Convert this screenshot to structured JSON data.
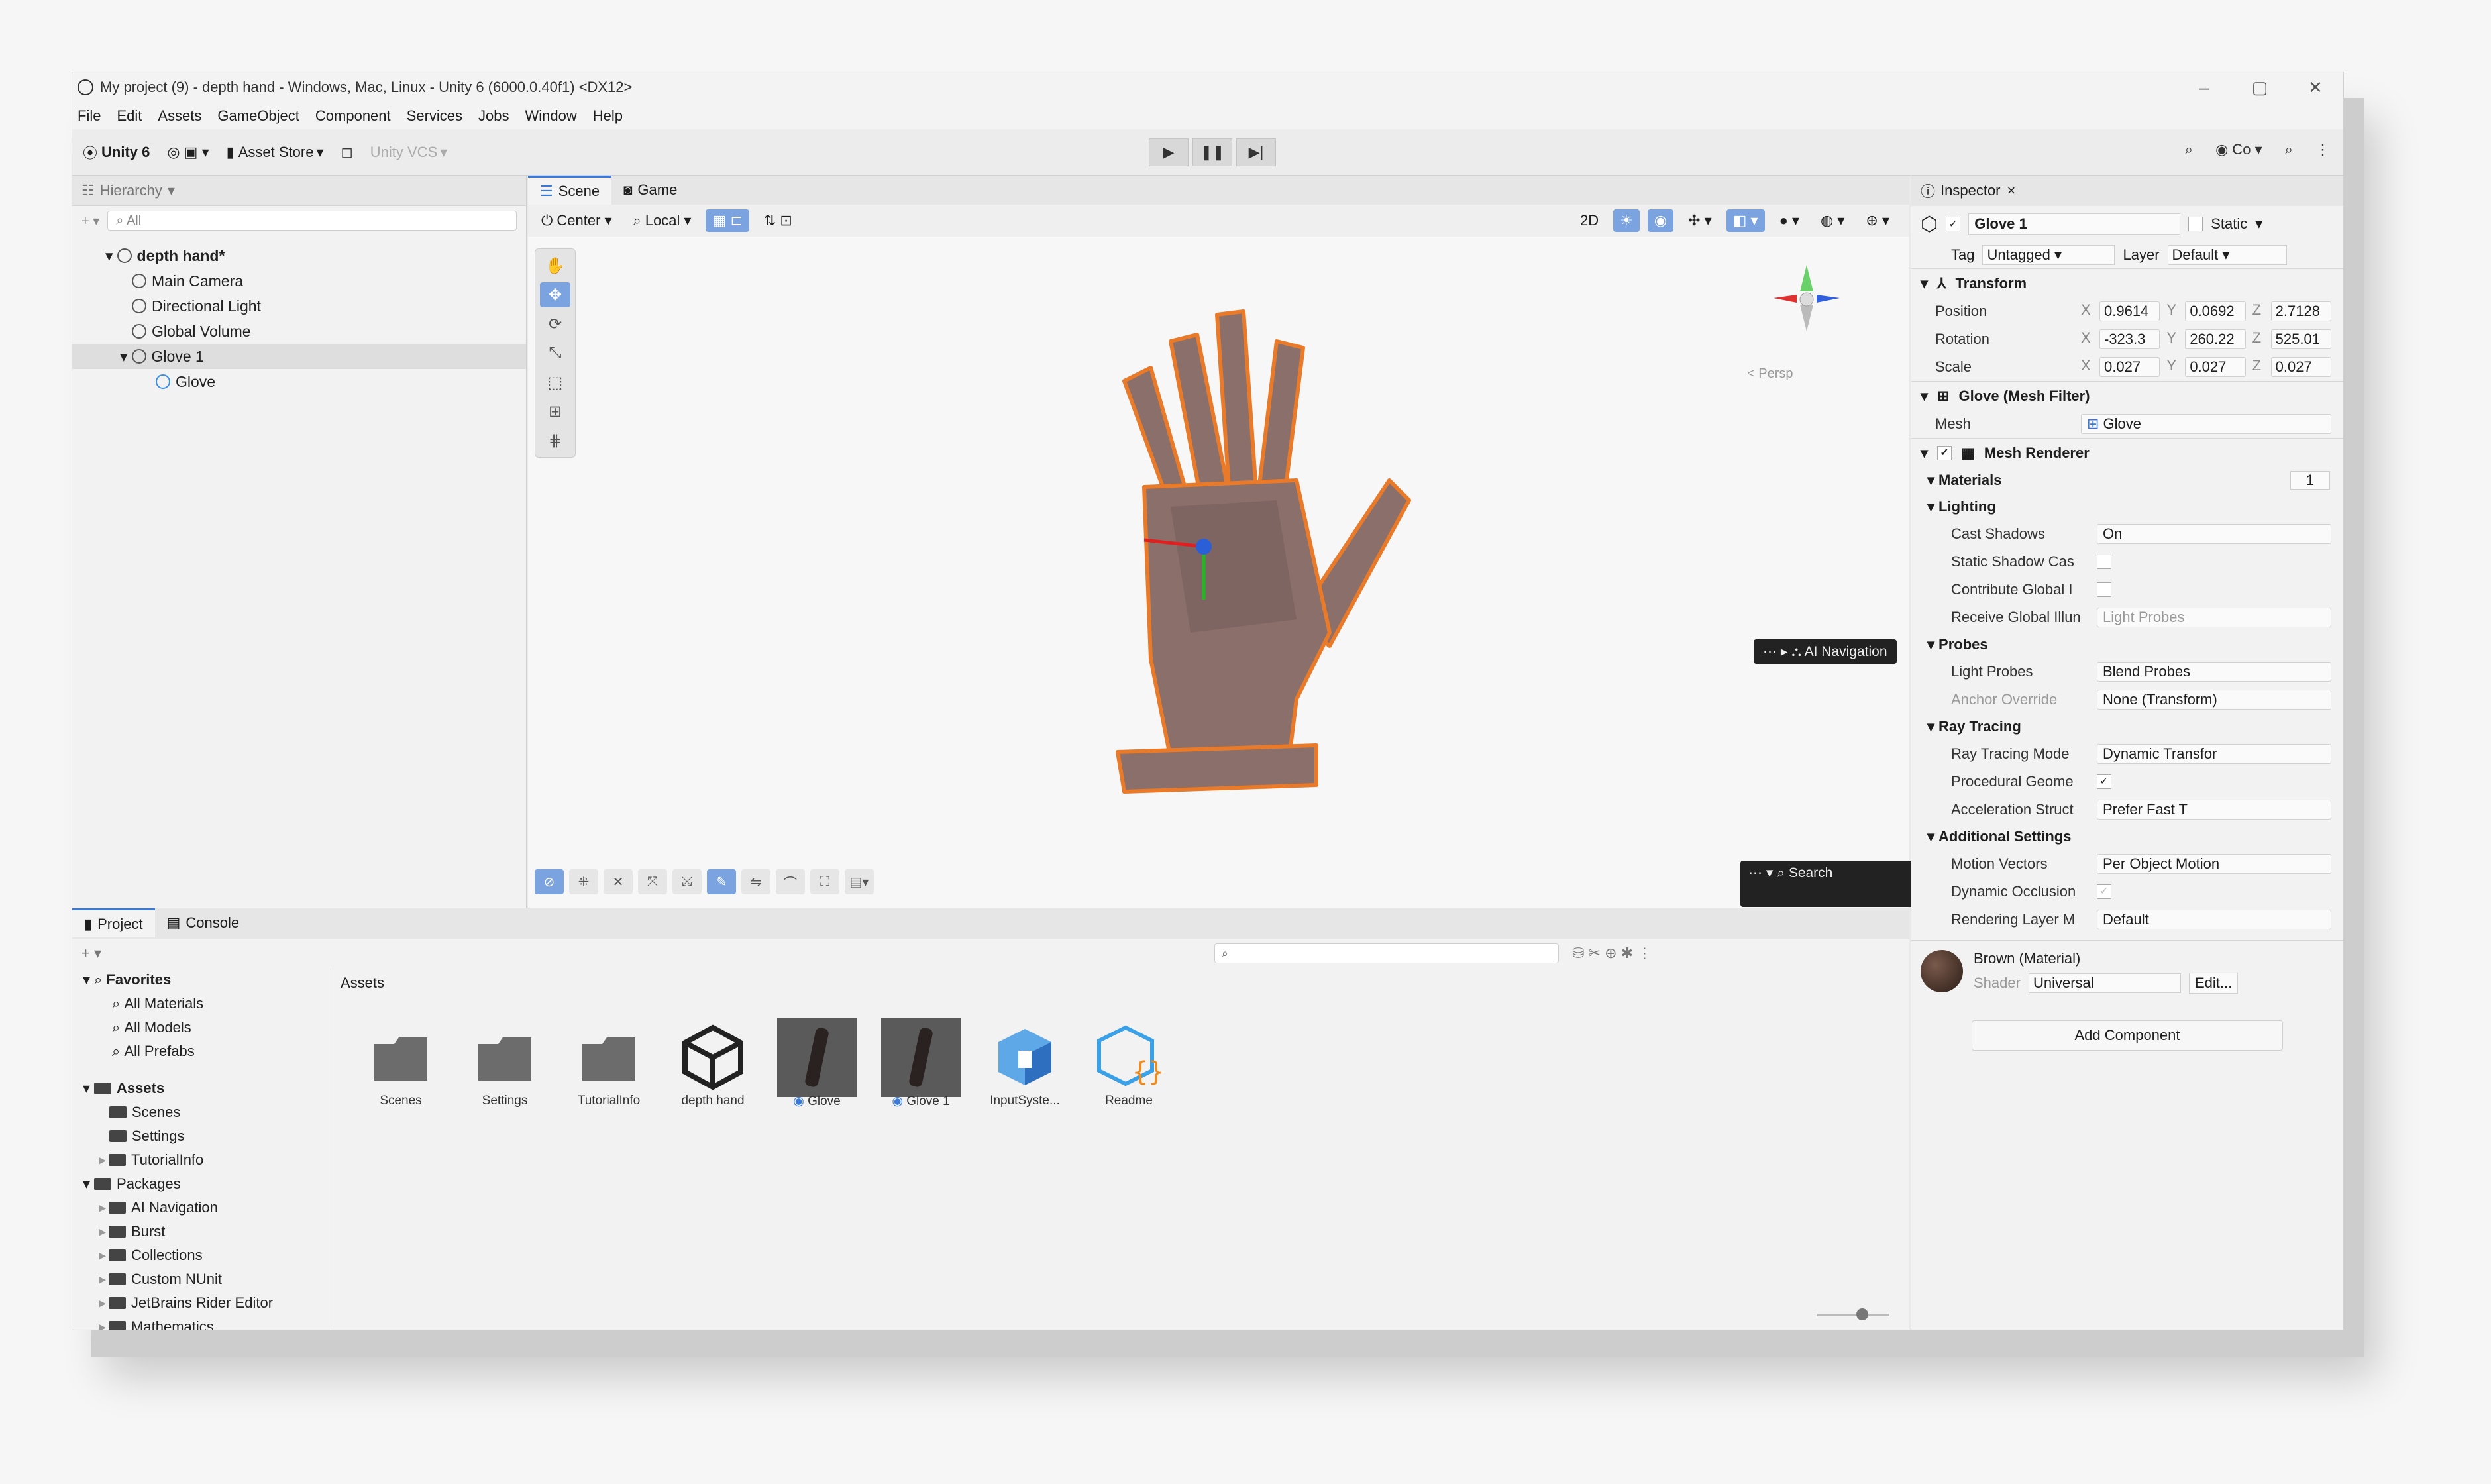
{
  "window": {
    "title": "My project (9) - depth hand - Windows, Mac, Linux - Unity 6 (6000.0.40f1) <DX12>",
    "controls": [
      "–",
      "▢",
      "✕"
    ]
  },
  "menu": [
    "File",
    "Edit",
    "Assets",
    "GameObject",
    "Component",
    "Services",
    "Jobs",
    "Window",
    "Help"
  ],
  "toolbar": {
    "account": "Unity 6",
    "asset_store": "Asset Store",
    "vcs": "Unity VCS",
    "right_co": "Co"
  },
  "hierarchy": {
    "tab": "Hierarchy",
    "search_placeholder": "All",
    "items": [
      {
        "label": "depth hand*"
      },
      {
        "label": "Main Camera"
      },
      {
        "label": "Directional Light"
      },
      {
        "label": "Global Volume"
      },
      {
        "label": "Glove 1"
      },
      {
        "label": "Glove"
      }
    ]
  },
  "scene": {
    "tabs": [
      "Scene",
      "Game"
    ],
    "pivot": "Center",
    "space": "Local",
    "mode_2d": "2D",
    "persp": "< Persp",
    "ai_nav": "AI Navigation",
    "search": "Search"
  },
  "project": {
    "tabs": [
      "Project",
      "Console"
    ],
    "breadcrumb": "Assets",
    "tree": [
      {
        "label": "Favorites"
      },
      {
        "label": "All Materials"
      },
      {
        "label": "All Models"
      },
      {
        "label": "All Prefabs"
      },
      {
        "label": "Assets"
      },
      {
        "label": "Scenes"
      },
      {
        "label": "Settings"
      },
      {
        "label": "TutorialInfo"
      },
      {
        "label": "Packages"
      },
      {
        "label": "AI Navigation"
      },
      {
        "label": "Burst"
      },
      {
        "label": "Collections"
      },
      {
        "label": "Custom NUnit"
      },
      {
        "label": "JetBrains Rider Editor"
      },
      {
        "label": "Mathematics"
      }
    ],
    "assets": [
      "Scenes",
      "Settings",
      "TutorialInfo",
      "depth hand",
      "Glove",
      "Glove 1",
      "InputSyste...",
      "Readme"
    ]
  },
  "inspector": {
    "tab": "Inspector",
    "object_name": "Glove 1",
    "static_label": "Static",
    "tag_label": "Tag",
    "tag_value": "Untagged",
    "layer_label": "Layer",
    "layer_value": "Default",
    "transform": {
      "title": "Transform",
      "position_label": "Position",
      "pos_x": "0.9614",
      "pos_y": "0.0692",
      "pos_z": "2.7128",
      "rotation_label": "Rotation",
      "rot_x": "-323.3",
      "rot_y": "260.22",
      "rot_z": "525.01",
      "scale_label": "Scale",
      "scl_x": "0.027",
      "scl_y": "0.027",
      "scl_z": "0.027"
    },
    "mesh_filter": {
      "title": "Glove (Mesh Filter)",
      "mesh_label": "Mesh",
      "mesh_value": "Glove"
    },
    "mesh_renderer": {
      "title": "Mesh Renderer",
      "materials": "Materials",
      "materials_count": "1",
      "lighting": "Lighting",
      "cast_shadows_label": "Cast Shadows",
      "cast_shadows_value": "On",
      "static_shadow_label": "Static Shadow Cas",
      "contribute_gi_label": "Contribute Global I",
      "receive_gi_label": "Receive Global Illun",
      "receive_gi_value": "Light Probes",
      "probes": "Probes",
      "light_probes_label": "Light Probes",
      "light_probes_value": "Blend Probes",
      "anchor_label": "Anchor Override",
      "anchor_value": "None (Transform)",
      "ray_tracing": "Ray Tracing",
      "rt_mode_label": "Ray Tracing Mode",
      "rt_mode_value": "Dynamic Transfor",
      "procedural_label": "Procedural Geome",
      "accel_label": "Acceleration Struct",
      "accel_value": "Prefer Fast T",
      "additional": "Additional Settings",
      "motion_label": "Motion Vectors",
      "motion_value": "Per Object Motion",
      "occlusion_label": "Dynamic Occlusion",
      "rlm_label": "Rendering Layer M",
      "rlm_value": "Default"
    },
    "material": {
      "title": "Brown (Material)",
      "shader_label": "Shader",
      "shader_value": "Universal",
      "edit": "Edit..."
    },
    "add_component": "Add Component"
  }
}
